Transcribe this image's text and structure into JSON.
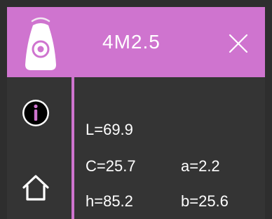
{
  "header": {
    "title": "4M2.5",
    "close_icon": "close-icon"
  },
  "sidebar": {
    "items": [
      {
        "icon": "measuring-device-icon"
      },
      {
        "icon": "info-icon"
      },
      {
        "icon": "home-icon"
      }
    ]
  },
  "readings": {
    "L": "L=69.9",
    "C": "C=25.7",
    "a": "a=2.2",
    "h": "h=85.2",
    "b": "b=25.6"
  },
  "colors": {
    "accent": "#cf74cf",
    "panel": "#343434",
    "background": "#2e2e2e",
    "text": "#ffffff"
  }
}
